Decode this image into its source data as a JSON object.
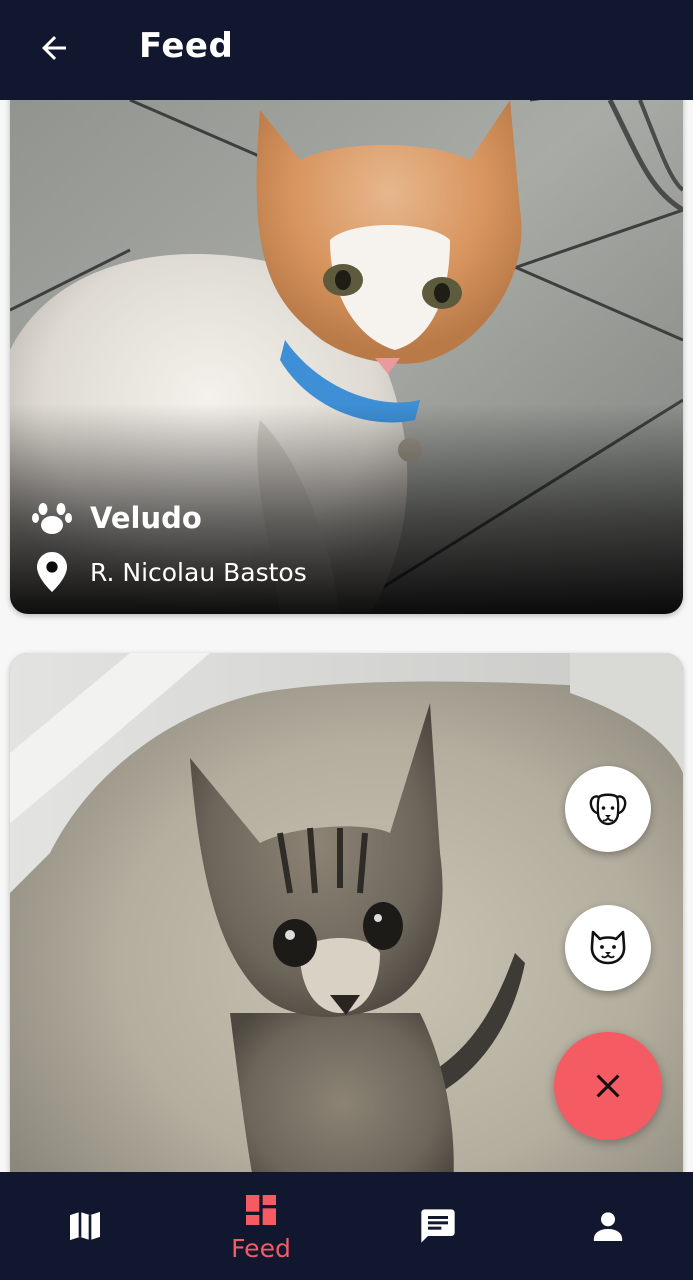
{
  "header": {
    "title": "Feed",
    "back_icon": "arrow-left-icon"
  },
  "feed": {
    "posts": [
      {
        "name": "Veludo",
        "address": "R. Nicolau Bastos",
        "photo": "white-orange-cat-photo"
      },
      {
        "name": "",
        "address": "",
        "photo": "tabby-kitten-photo"
      }
    ]
  },
  "fab": {
    "dog_icon": "dog-face-icon",
    "cat_icon": "cat-face-icon",
    "close_icon": "close-icon",
    "accent_color": "#f45b62"
  },
  "bottom_nav": {
    "items": [
      {
        "icon": "map-icon",
        "label": ""
      },
      {
        "icon": "dashboard-icon",
        "label": "Feed"
      },
      {
        "icon": "chat-icon",
        "label": ""
      },
      {
        "icon": "person-icon",
        "label": ""
      }
    ],
    "active_index": 1,
    "background": "#11172f"
  }
}
